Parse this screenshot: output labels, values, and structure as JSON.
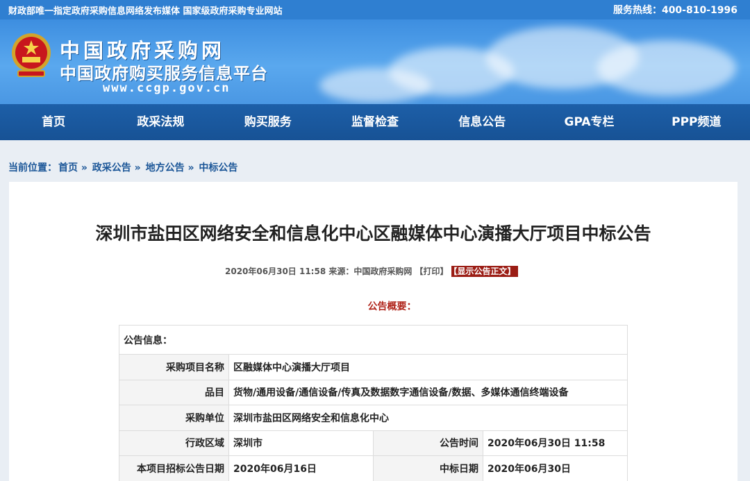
{
  "topbar": {
    "left_text": "财政部唯一指定政府采购信息网络发布媒体 国家级政府采购专业网站",
    "hotline": "服务热线：400-810-1996"
  },
  "banner": {
    "title": "中国政府采购网",
    "subtitle": "中国政府购买服务信息平台",
    "url": "www.ccgp.gov.cn"
  },
  "nav": [
    "首页",
    "政采法规",
    "购买服务",
    "监督检查",
    "信息公告",
    "GPA专栏",
    "PPP频道"
  ],
  "breadcrumb": {
    "prefix": "当前位置：",
    "items": [
      "首页 »",
      "政采公告 »",
      "地方公告 »",
      "中标公告"
    ]
  },
  "article": {
    "title": "深圳市盐田区网络安全和信息化中心区融媒体中心演播大厅项目中标公告",
    "meta": "2020年06月30日 11:58 来源：中国政府采购网 【打印】",
    "show_button": "【显示公告正文】",
    "summary_label": "公告概要："
  },
  "info_table": {
    "header": "公告信息：",
    "rows": [
      {
        "label": "采购项目名称",
        "value": "区融媒体中心演播大厅项目"
      },
      {
        "label": "品目",
        "value": "货物/通用设备/通信设备/传真及数据数字通信设备/数据、多媒体通信终端设备"
      },
      {
        "label": "采购单位",
        "value": "深圳市盐田区网络安全和信息化中心"
      }
    ],
    "pair_rows": [
      {
        "label1": "行政区域",
        "value1": "深圳市",
        "label2": "公告时间",
        "value2": "2020年06月30日 11:58"
      },
      {
        "label1": "本项目招标公告日期",
        "value1": "2020年06月16日",
        "label2": "中标日期",
        "value2": "2020年06月30日"
      }
    ]
  }
}
